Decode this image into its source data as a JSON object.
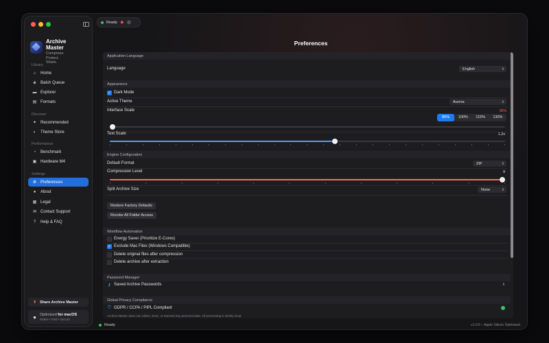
{
  "app": {
    "name": "Archive Master",
    "tagline": "Compress. Protect. Share."
  },
  "sidebar": {
    "sections": [
      {
        "title": "Library",
        "items": [
          {
            "label": "Home",
            "icon": "home-icon"
          },
          {
            "label": "Batch Queue",
            "icon": "layers-icon"
          },
          {
            "label": "Explorer",
            "icon": "folder-icon"
          },
          {
            "label": "Formats",
            "icon": "doc-icon"
          }
        ]
      },
      {
        "title": "Discover",
        "items": [
          {
            "label": "Recommended",
            "icon": "sparkle-icon"
          },
          {
            "label": "Theme Store",
            "icon": "palette-icon"
          }
        ]
      },
      {
        "title": "Performance",
        "items": [
          {
            "label": "Benchmark",
            "icon": "gauge-icon"
          },
          {
            "label": "Hardware M4",
            "icon": "chip-icon"
          }
        ]
      },
      {
        "title": "Settings",
        "items": [
          {
            "label": "Preferences",
            "icon": "gear-icon",
            "active": true
          },
          {
            "label": "About",
            "icon": "info-icon"
          },
          {
            "label": "Legal",
            "icon": "legal-icon"
          },
          {
            "label": "Contact Support",
            "icon": "mail-icon"
          },
          {
            "label": "Help & FAQ",
            "icon": "help-icon"
          }
        ]
      }
    ],
    "share_label": "Share Archive Master",
    "optimized_prefix": "Optimized ",
    "optimized_bold": "for macOS",
    "optimized_sub": "Native • Fast • Secure"
  },
  "topbar": {
    "status": "Ready"
  },
  "page": {
    "title": "Preferences"
  },
  "preferences": {
    "language_section": "Application Language",
    "language_label": "Language",
    "language_value": "English",
    "appearance_section": "Appearance",
    "dark_mode_label": "Dark Mode",
    "dark_mode_checked": true,
    "theme_label": "Active Theme",
    "theme_value": "Aurora",
    "interface_scale_label": "Interface Scale",
    "interface_scale_value": "85%",
    "interface_scale_options": [
      "85%",
      "100%",
      "115%",
      "130%"
    ],
    "interface_scale_selected": "85%",
    "interface_scale_slider_fraction": 0.0,
    "text_scale_label": "Text Scale",
    "text_scale_value": "1.2x",
    "text_scale_fraction": 0.57,
    "engine_section": "Engine Configuration",
    "default_format_label": "Default Format",
    "default_format_value": "ZIP",
    "compression_label": "Compression Level",
    "compression_value": "9",
    "compression_fraction": 1.0,
    "split_label": "Split Archive Size",
    "split_value": "None",
    "restore_button": "Restore Factory Defaults",
    "revoke_button": "Revoke All Folder Access",
    "workflow_section": "Workflow Automation",
    "workflow_options": [
      {
        "label": "Energy Saver (Prioritize E-Cores)",
        "checked": false
      },
      {
        "label": "Exclude Mac Files (Windows Compatible)",
        "checked": true
      },
      {
        "label": "Delete original files after compression",
        "checked": false
      },
      {
        "label": "Delete archive after extraction",
        "checked": false
      }
    ],
    "password_section": "Password Manager",
    "saved_passwords_label": "Saved Archive Passwords",
    "privacy_section": "Global Privacy Compliance",
    "privacy_label": "GDPR / CCPA / PIPL Compliant",
    "privacy_note": "Archive Master does not collect, store, or transmit any personal data. All processing is strictly local."
  },
  "statusbar": {
    "status": "Ready",
    "version": "v1.0.6 – Apple Silicon Optimized"
  },
  "colors": {
    "accent": "#1f7bf0",
    "compression_slider": "#ff6b6b",
    "text_slider": "#4da3ff",
    "ready": "#34c759"
  }
}
